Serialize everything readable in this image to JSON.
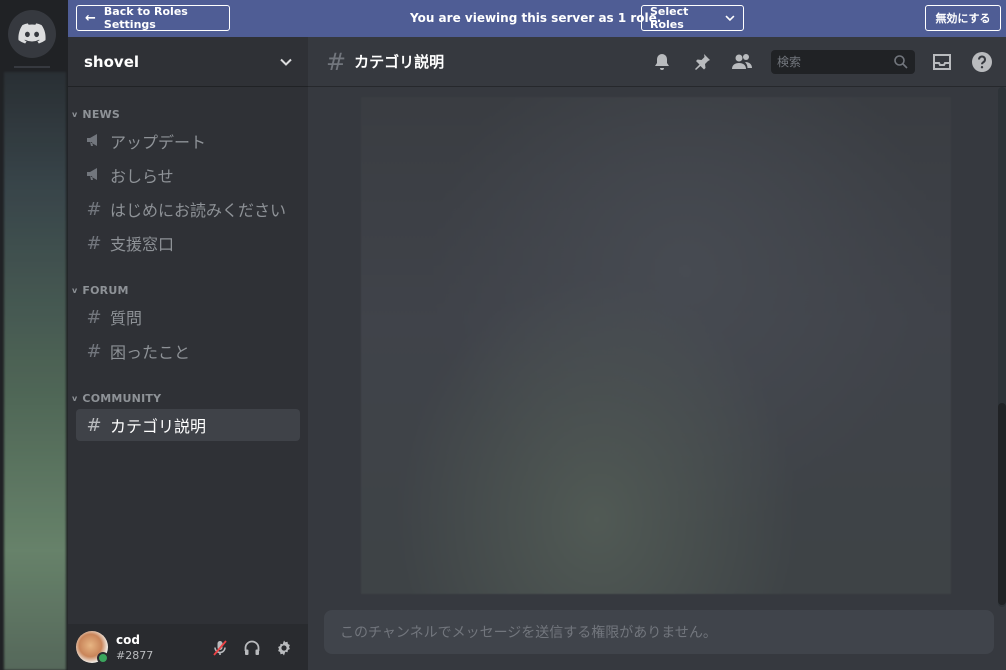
{
  "banner": {
    "back_label": "Back to Roles Settings",
    "viewing_text": "You are viewing this server as 1 role.",
    "select_roles_label": "Select Roles",
    "disable_label": "無効にする",
    "color": "#4f5d95"
  },
  "server": {
    "name": "shovel"
  },
  "categories": [
    {
      "name": "NEWS"
    },
    {
      "name": "FORUM"
    },
    {
      "name": "COMMUNITY"
    }
  ],
  "channels": {
    "news": [
      {
        "name": "アップデート",
        "icon": "megaphone-icon"
      },
      {
        "name": "おしらせ",
        "icon": "megaphone-icon"
      },
      {
        "name": "はじめにお読みください",
        "icon": "hash-icon"
      },
      {
        "name": "支援窓口",
        "icon": "hash-icon"
      }
    ],
    "forum": [
      {
        "name": "質問",
        "icon": "hash-icon"
      },
      {
        "name": "困ったこと",
        "icon": "hash-icon"
      }
    ],
    "community": [
      {
        "name": "カテゴリ説明",
        "icon": "hash-icon",
        "active": true
      }
    ]
  },
  "header": {
    "channel_name": "カテゴリ説明",
    "search_placeholder": "検索"
  },
  "user": {
    "name": "cod",
    "tag": "#2877",
    "status_color": "#3ba55d"
  },
  "composer": {
    "disabled_text": "このチャンネルでメッセージを送信する権限がありません。"
  }
}
